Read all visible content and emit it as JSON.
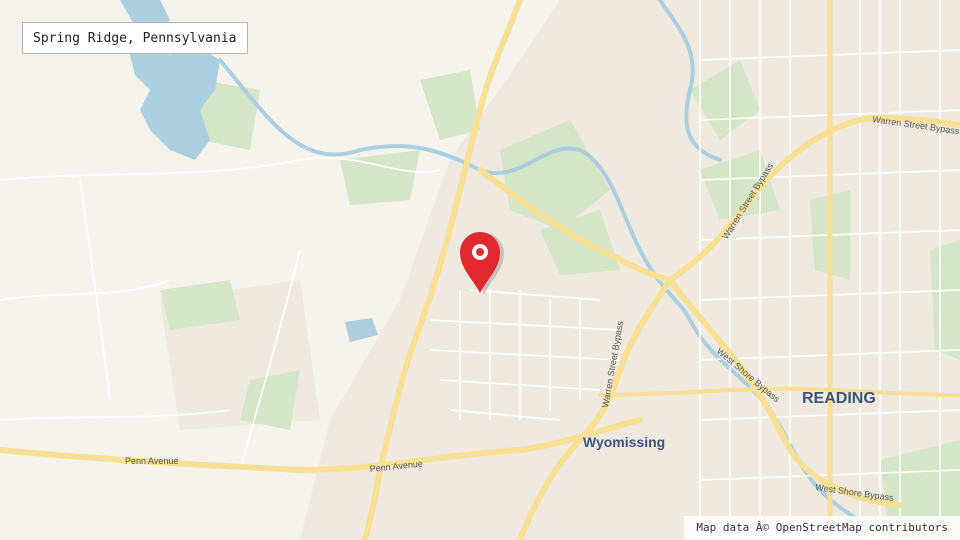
{
  "location": {
    "name": "Spring Ridge, Pennsylvania"
  },
  "places": {
    "reading": "READING",
    "wyomissing": "Wyomissing"
  },
  "roads": {
    "penn_avenue_west": "Penn Avenue",
    "penn_avenue_east": "Penn Avenue",
    "warren_street_bypass_north": "Warren Street Bypass",
    "warren_street_bypass_south": "Warren Street Bypass",
    "warren_street_bypass_east": "Warren Street Bypass",
    "west_shore_bypass_north": "West Shore Bypass",
    "west_shore_bypass_south": "West Shore Bypass"
  },
  "attribution": "Map data Â© OpenStreetMap contributors",
  "marker": {
    "icon": "map-pin-icon",
    "color": "#e0282e"
  },
  "colors": {
    "land": "#f6f3ec",
    "urban": "#efe9df",
    "park": "#d5e5c7",
    "water": "#aacfe0",
    "major_road": "#f7df94",
    "minor_road": "#ffffff",
    "place_label": "#3c5380"
  }
}
